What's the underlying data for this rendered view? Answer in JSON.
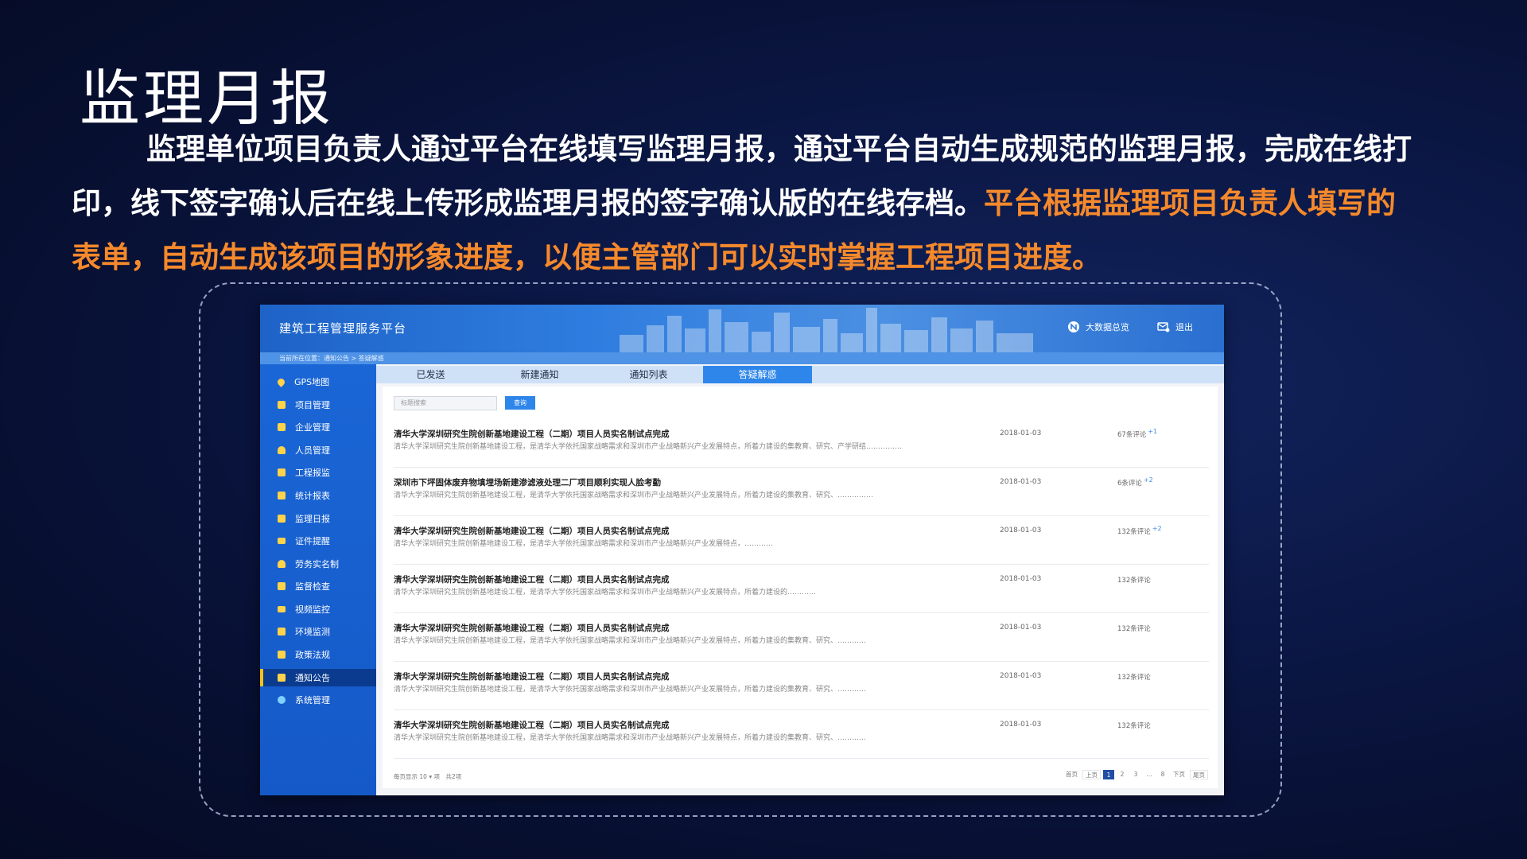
{
  "slide": {
    "title": "监理月报",
    "intro_part1": "监理单位项目负责人通过平台在线填写监理月报，通过平台自动生成规范的监理月报，完成在线打印，线下签字确认后在线上传形成监理月报的签字确认版的在线存档。",
    "intro_part2": "平台根据监理项目负责人填写的表单，自动生成该项目的形象进度，以便主管部门可以实时掌握工程项目进度。",
    "highlight_color": "#f5892b"
  },
  "app": {
    "name": "建筑工程管理服务平台",
    "header_links": {
      "bigdata": "大数据总览",
      "logout": "退出"
    },
    "breadcrumb": "当前所在位置：通知公告 > 答疑解惑",
    "sidebar": [
      {
        "label": "GPS地图",
        "icon": "map-pin-icon"
      },
      {
        "label": "项目管理",
        "icon": "folder-icon"
      },
      {
        "label": "企业管理",
        "icon": "building-icon"
      },
      {
        "label": "人员管理",
        "icon": "person-icon"
      },
      {
        "label": "工程报监",
        "icon": "edit-icon"
      },
      {
        "label": "统计报表",
        "icon": "chart-icon"
      },
      {
        "label": "监理日报",
        "icon": "document-icon"
      },
      {
        "label": "证件提醒",
        "icon": "id-card-icon"
      },
      {
        "label": "劳务实名制",
        "icon": "worker-icon"
      },
      {
        "label": "监督检查",
        "icon": "grid-icon"
      },
      {
        "label": "视频监控",
        "icon": "camera-icon"
      },
      {
        "label": "环境监测",
        "icon": "leaf-icon"
      },
      {
        "label": "政策法规",
        "icon": "book-icon"
      },
      {
        "label": "通知公告",
        "icon": "speaker-icon",
        "active": true
      },
      {
        "label": "系统管理",
        "icon": "gear-icon"
      }
    ],
    "tabs": [
      "已发送",
      "新建通知",
      "通知列表",
      "答疑解惑"
    ],
    "active_tab": 3,
    "search": {
      "placeholder": "标题搜索",
      "button": "查询"
    },
    "rows": [
      {
        "title": "清华大学深圳研究生院创新基地建设工程（二期）项目人员实名制试点完成",
        "desc": "清华大学深圳研究生院创新基地建设工程，是清华大学依托国家战略需求和深圳市产业战略新兴产业发展特点，所着力建设的集教育、研究、产学研结……………",
        "date": "2018-01-03",
        "comments": "67条评论",
        "badge": "+1"
      },
      {
        "title": "深圳市下坪固体废弃物填埋场新建渗滤液处理二厂项目顺利实现人脸考勤",
        "desc": "清华大学深圳研究生院创新基地建设工程，是清华大学依托国家战略需求和深圳市产业战略新兴产业发展特点，所着力建设的集教育、研究、……………",
        "date": "2018-01-03",
        "comments": "6条评论",
        "badge": "+2"
      },
      {
        "title": "清华大学深圳研究生院创新基地建设工程（二期）项目人员实名制试点完成",
        "desc": "清华大学深圳研究生院创新基地建设工程，是清华大学依托国家战略需求和深圳市产业战略新兴产业发展特点，…………",
        "date": "2018-01-03",
        "comments": "132条评论",
        "badge": "+2"
      },
      {
        "title": "清华大学深圳研究生院创新基地建设工程（二期）项目人员实名制试点完成",
        "desc": "清华大学深圳研究生院创新基地建设工程，是清华大学依托国家战略需求和深圳市产业战略新兴产业发展特点，所着力建设的…………",
        "date": "2018-01-03",
        "comments": "132条评论",
        "badge": ""
      },
      {
        "title": "清华大学深圳研究生院创新基地建设工程（二期）项目人员实名制试点完成",
        "desc": "清华大学深圳研究生院创新基地建设工程，是清华大学依托国家战略需求和深圳市产业战略新兴产业发展特点，所着力建设的集教育、研究、…………",
        "date": "2018-01-03",
        "comments": "132条评论",
        "badge": ""
      },
      {
        "title": "清华大学深圳研究生院创新基地建设工程（二期）项目人员实名制试点完成",
        "desc": "清华大学深圳研究生院创新基地建设工程，是清华大学依托国家战略需求和深圳市产业战略新兴产业发展特点，所着力建设的集教育、研究、…………",
        "date": "2018-01-03",
        "comments": "132条评论",
        "badge": ""
      },
      {
        "title": "清华大学深圳研究生院创新基地建设工程（二期）项目人员实名制试点完成",
        "desc": "清华大学深圳研究生院创新基地建设工程，是清华大学依托国家战略需求和深圳市产业战略新兴产业发展特点，所着力建设的集教育、研究、…………",
        "date": "2018-01-03",
        "comments": "132条评论",
        "badge": ""
      }
    ],
    "footer": {
      "per_page_label": "每页显示",
      "per_page_value": "10",
      "total": "项　共2项"
    },
    "pager": [
      "首页",
      "上页",
      "1",
      "2",
      "3",
      "...",
      "8",
      "下页",
      "尾页"
    ],
    "pager_active": "1"
  }
}
